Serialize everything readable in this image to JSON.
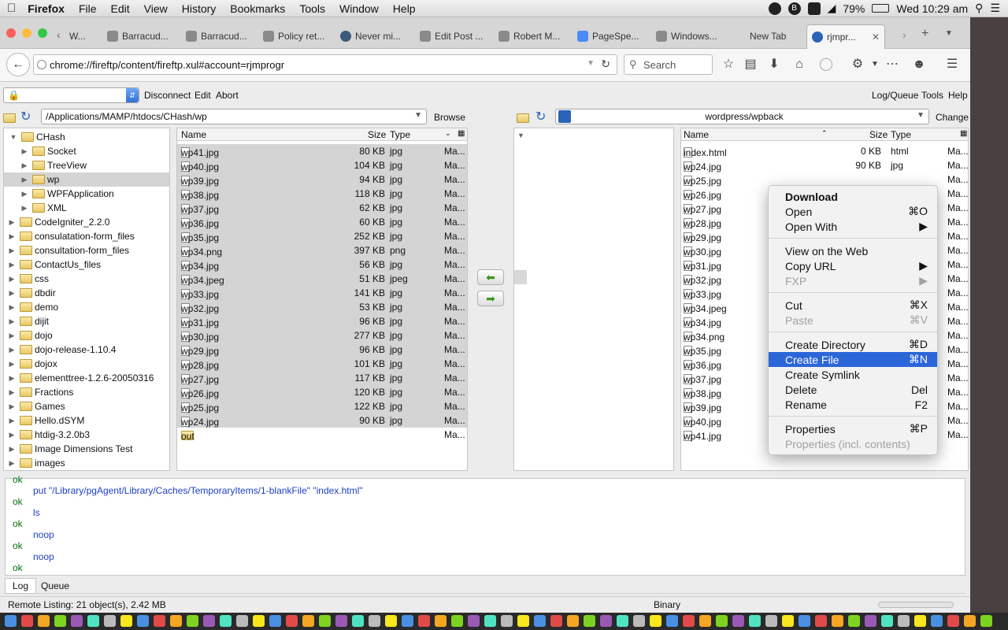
{
  "menubar": {
    "app": "Firefox",
    "items": [
      "File",
      "Edit",
      "View",
      "History",
      "Bookmarks",
      "Tools",
      "Window",
      "Help"
    ],
    "battery": "79%",
    "clock": "Wed 10:29 am"
  },
  "tabs": [
    "W...",
    "Barracud...",
    "Barracud...",
    "Policy ret...",
    "Never mi...",
    "Edit Post ...",
    "Robert M...",
    "PageSpe...",
    "Windows...",
    "New Tab",
    "rjmpr..."
  ],
  "nav": {
    "url": "chrome://fireftp/content/fireftp.xul#account=rjmprogr",
    "search_placeholder": "Search"
  },
  "ftp_toolbar": {
    "disconnect": "Disconnect",
    "edit": "Edit",
    "abort": "Abort",
    "logqueue": "Log/Queue",
    "tools": "Tools",
    "help": "Help"
  },
  "local": {
    "path": "/Applications/MAMP/htdocs/CHash/wp",
    "browse": "Browse",
    "headers": {
      "name": "Name",
      "size": "Size",
      "type": "Type"
    },
    "files": [
      {
        "name": "wp41.jpg",
        "size": "80 KB",
        "type": "jpg",
        "mod": "Ma..."
      },
      {
        "name": "wp40.jpg",
        "size": "104 KB",
        "type": "jpg",
        "mod": "Ma..."
      },
      {
        "name": "wp39.jpg",
        "size": "94 KB",
        "type": "jpg",
        "mod": "Ma..."
      },
      {
        "name": "wp38.jpg",
        "size": "118 KB",
        "type": "jpg",
        "mod": "Ma..."
      },
      {
        "name": "wp37.jpg",
        "size": "62 KB",
        "type": "jpg",
        "mod": "Ma..."
      },
      {
        "name": "wp36.jpg",
        "size": "60 KB",
        "type": "jpg",
        "mod": "Ma..."
      },
      {
        "name": "wp35.jpg",
        "size": "252 KB",
        "type": "jpg",
        "mod": "Ma..."
      },
      {
        "name": "wp34.png",
        "size": "397 KB",
        "type": "png",
        "mod": "Ma..."
      },
      {
        "name": "wp34.jpg",
        "size": "56 KB",
        "type": "jpg",
        "mod": "Ma..."
      },
      {
        "name": "wp34.jpeg",
        "size": "51 KB",
        "type": "jpeg",
        "mod": "Ma..."
      },
      {
        "name": "wp33.jpg",
        "size": "141 KB",
        "type": "jpg",
        "mod": "Ma..."
      },
      {
        "name": "wp32.jpg",
        "size": "53 KB",
        "type": "jpg",
        "mod": "Ma..."
      },
      {
        "name": "wp31.jpg",
        "size": "96 KB",
        "type": "jpg",
        "mod": "Ma..."
      },
      {
        "name": "wp30.jpg",
        "size": "277 KB",
        "type": "jpg",
        "mod": "Ma..."
      },
      {
        "name": "wp29.jpg",
        "size": "96 KB",
        "type": "jpg",
        "mod": "Ma..."
      },
      {
        "name": "wp28.jpg",
        "size": "101 KB",
        "type": "jpg",
        "mod": "Ma..."
      },
      {
        "name": "wp27.jpg",
        "size": "117 KB",
        "type": "jpg",
        "mod": "Ma..."
      },
      {
        "name": "wp26.jpg",
        "size": "120 KB",
        "type": "jpg",
        "mod": "Ma..."
      },
      {
        "name": "wp25.jpg",
        "size": "122 KB",
        "type": "jpg",
        "mod": "Ma..."
      },
      {
        "name": "wp24.jpg",
        "size": "90 KB",
        "type": "jpg",
        "mod": "Ma..."
      },
      {
        "name": "out",
        "size": "",
        "type": "",
        "mod": "Ma..."
      }
    ]
  },
  "tree": [
    "CHash",
    "Socket",
    "TreeView",
    "wp",
    "WPFApplication",
    "XML",
    "CodeIgniter_2.2.0",
    "consulatation-form_files",
    "consultation-form_files",
    "ContactUs_files",
    "css",
    "dbdir",
    "demo",
    "dijit",
    "dojo",
    "dojo-release-1.10.4",
    "dojox",
    "elementtree-1.2.6-20050316",
    "Fractions",
    "Games",
    "Hello.dSYM",
    "htdig-3.2.0b3",
    "Image Dimensions Test",
    "images"
  ],
  "remote": {
    "path": "wordpress/wpback",
    "change": "Change",
    "headers": {
      "name": "Name",
      "size": "Size",
      "type": "Type"
    },
    "files": [
      {
        "name": "index.html",
        "size": "0 KB",
        "type": "html",
        "mod": "Ma..."
      },
      {
        "name": "wp24.jpg",
        "size": "90 KB",
        "type": "jpg",
        "mod": "Ma..."
      },
      {
        "name": "wp25.jpg",
        "mod": "Ma..."
      },
      {
        "name": "wp26.jpg",
        "mod": "Ma..."
      },
      {
        "name": "wp27.jpg",
        "mod": "Ma..."
      },
      {
        "name": "wp28.jpg",
        "mod": "Ma..."
      },
      {
        "name": "wp29.jpg",
        "mod": "Ma..."
      },
      {
        "name": "wp30.jpg",
        "mod": "Ma..."
      },
      {
        "name": "wp31.jpg",
        "mod": "Ma..."
      },
      {
        "name": "wp32.jpg",
        "mod": "Ma..."
      },
      {
        "name": "wp33.jpg",
        "mod": "Ma..."
      },
      {
        "name": "wp34.jpeg",
        "mod": "Ma..."
      },
      {
        "name": "wp34.jpg",
        "mod": "Ma..."
      },
      {
        "name": "wp34.png",
        "mod": "Ma..."
      },
      {
        "name": "wp35.jpg",
        "mod": "Ma..."
      },
      {
        "name": "wp36.jpg",
        "mod": "Ma..."
      },
      {
        "name": "wp37.jpg",
        "mod": "Ma..."
      },
      {
        "name": "wp38.jpg",
        "mod": "Ma..."
      },
      {
        "name": "wp39.jpg",
        "mod": "Ma..."
      },
      {
        "name": "wp40.jpg",
        "mod": "Ma..."
      },
      {
        "name": "wp41.jpg",
        "mod": "Ma..."
      }
    ]
  },
  "context_menu": [
    {
      "label": "Download",
      "shortcut": "",
      "bold": true
    },
    {
      "label": "Open",
      "shortcut": "⌘O"
    },
    {
      "label": "Open With",
      "shortcut": "▶"
    },
    {
      "sep": true
    },
    {
      "label": "View on the Web",
      "shortcut": ""
    },
    {
      "label": "Copy URL",
      "shortcut": "▶"
    },
    {
      "label": "FXP",
      "shortcut": "▶",
      "disabled": true
    },
    {
      "sep": true
    },
    {
      "label": "Cut",
      "shortcut": "⌘X"
    },
    {
      "label": "Paste",
      "shortcut": "⌘V",
      "disabled": true
    },
    {
      "sep": true
    },
    {
      "label": "Create Directory",
      "shortcut": "⌘D"
    },
    {
      "label": "Create File",
      "shortcut": "⌘N",
      "highlight": true
    },
    {
      "label": "Create Symlink",
      "shortcut": ""
    },
    {
      "label": "Delete",
      "shortcut": "Del"
    },
    {
      "label": "Rename",
      "shortcut": "F2"
    },
    {
      "sep": true
    },
    {
      "label": "Properties",
      "shortcut": "⌘P"
    },
    {
      "label": "Properties (incl. contents)",
      "shortcut": "",
      "disabled": true
    }
  ],
  "log": [
    {
      "status": "ok",
      "cmd": ""
    },
    {
      "status": "",
      "cmd": "put \"/Library/pgAgent/Library/Caches/TemporaryItems/1-blankFile\" \"index.html\""
    },
    {
      "status": "ok",
      "cmd": ""
    },
    {
      "status": "",
      "cmd": "ls"
    },
    {
      "status": "ok",
      "cmd": ""
    },
    {
      "status": "",
      "cmd": "noop"
    },
    {
      "status": "ok",
      "cmd": ""
    },
    {
      "status": "",
      "cmd": "noop"
    },
    {
      "status": "ok",
      "cmd": ""
    }
  ],
  "log_tabs": {
    "log": "Log",
    "queue": "Queue"
  },
  "status": {
    "listing": "Remote Listing: 21 object(s), 2.42 MB",
    "mode": "Binary"
  },
  "colors": {
    "selection": "#d4d4d4",
    "highlight": "#2b66d9",
    "ok": "#0a6b0a",
    "cmd": "#1c3fc6"
  }
}
